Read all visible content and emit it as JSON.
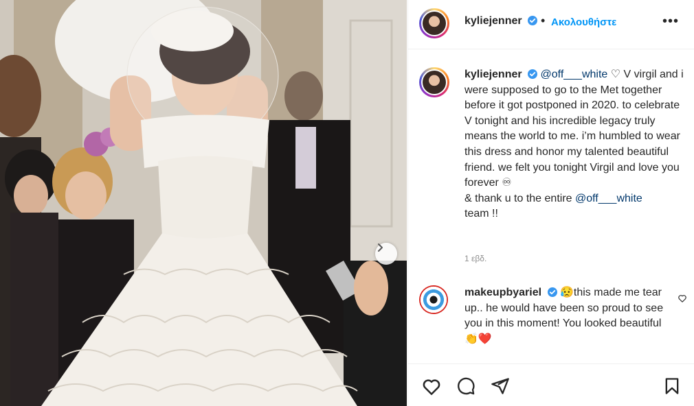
{
  "post": {
    "author": "kyliejenner",
    "follow_label": "Ακολουθήστε",
    "separator": "•",
    "more_label": "•••",
    "caption": {
      "author": "kyliejenner",
      "mention1": "@off___white",
      "heart": "♡",
      "line_a": " V virgil and i were supposed to go to the Met together before it got postponed in 2020. to celebrate V tonight and his incredible legacy truly means the world to me. i’m humbled to wear this dress and honor my talented beautiful friend. we felt you tonight Virgil and love you forever ♾",
      "line_b_prefix": "& thank u to the entire ",
      "mention2": "@off___white",
      "line_b_suffix": " team !!"
    },
    "time_ago": "1 εβδ."
  },
  "comment": {
    "author": "makeupbyariel",
    "emoji_sad": "😥",
    "text": "this made me tear up.. he would have been so proud to see you in this moment! You looked beautiful ",
    "emoji_end": "👏❤️"
  },
  "icons": {
    "like": "heart-icon",
    "comment": "comment-icon",
    "share": "share-icon",
    "save": "bookmark-icon",
    "next": "chevron-right-icon",
    "verified": "verified-badge-icon"
  },
  "colors": {
    "accent": "#0095f6",
    "mention": "#00376b",
    "verified": "#3897f0",
    "muted": "#8e8e8e"
  }
}
